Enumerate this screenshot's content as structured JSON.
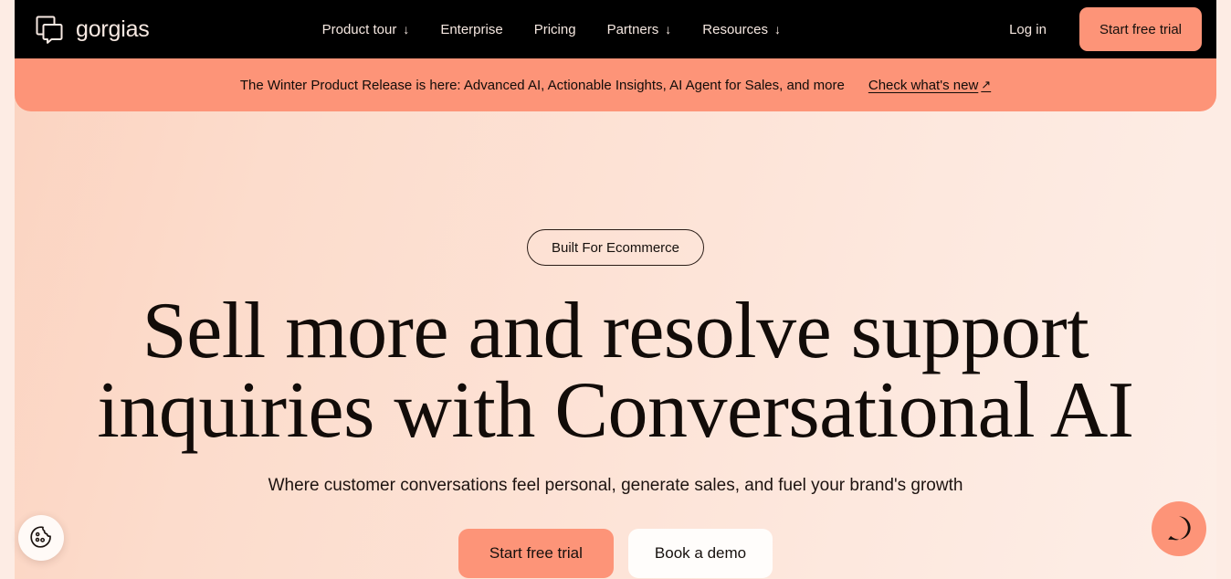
{
  "brand": {
    "name": "gorgias",
    "logo_icon": "gorgias-speech-square-logo"
  },
  "nav": {
    "items": [
      {
        "label": "Product tour",
        "caret": "↓",
        "has_caret": true
      },
      {
        "label": "Enterprise",
        "caret": "",
        "has_caret": false
      },
      {
        "label": "Pricing",
        "caret": "",
        "has_caret": false
      },
      {
        "label": "Partners",
        "caret": "↓",
        "has_caret": true
      },
      {
        "label": "Resources",
        "caret": "↓",
        "has_caret": true
      }
    ],
    "login_label": "Log in",
    "trial_label": "Start free trial"
  },
  "banner": {
    "text": "The Winter Product Release is here: Advanced AI, Actionable Insights, AI Agent for Sales, and more",
    "link_label": "Check what's new",
    "link_arrow": "↗"
  },
  "hero": {
    "eyebrow": "Built For Ecommerce",
    "headline": "Sell more and resolve support inquiries with Conversational AI",
    "subheadline": "Where customer conversations feel personal, generate sales, and fuel your brand's growth",
    "cta_primary": "Start free trial",
    "cta_secondary": "Book a demo"
  },
  "widgets": {
    "cookie_icon": "cookie-icon",
    "chat_icon": "chat-bubble-icon"
  },
  "colors": {
    "accent_coral": "#fd9478",
    "header_black": "#000000",
    "page_bg": "#fdece4",
    "text_dark": "#120c09"
  }
}
